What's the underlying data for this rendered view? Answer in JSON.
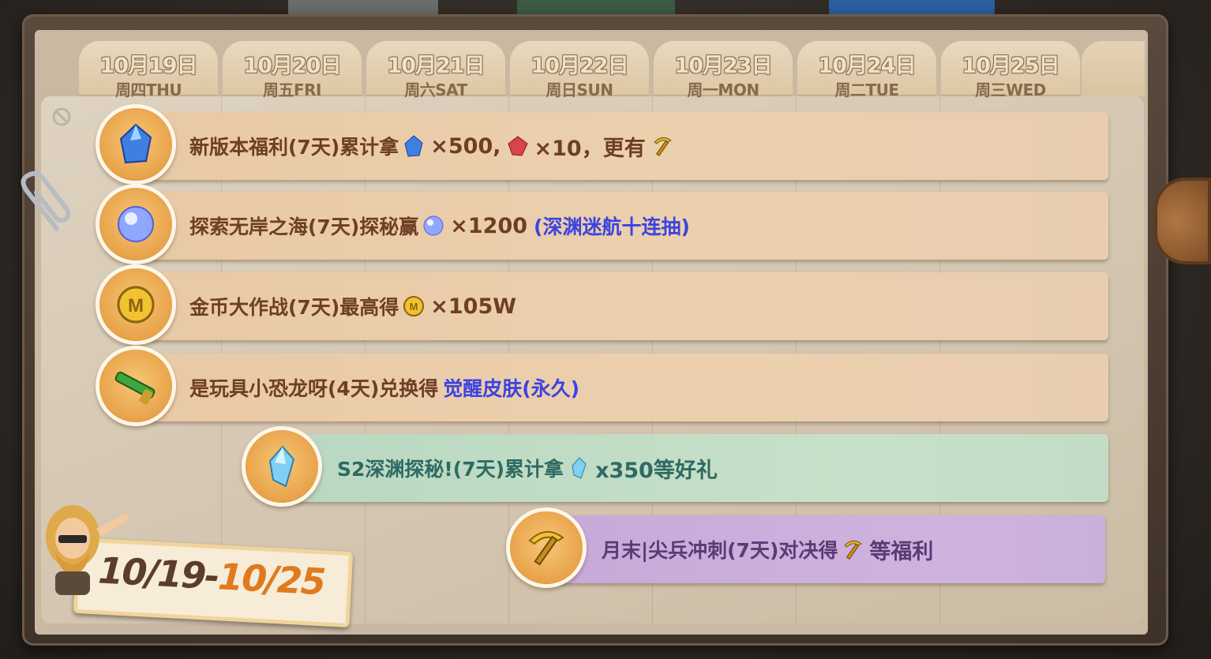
{
  "colors": {
    "frame": "#3d322a",
    "paper": "#d8cbb7",
    "orange_bar": "#ecd0ae",
    "green_bar": "#c8e0c9",
    "purple_bar": "#cfb3de",
    "highlight_blue": "#3b43e0",
    "tab_bg": "#e4d0b0"
  },
  "tabs": [
    {
      "date": "10月19日",
      "week": "周四THU"
    },
    {
      "date": "10月20日",
      "week": "周五FRI"
    },
    {
      "date": "10月21日",
      "week": "周六SAT"
    },
    {
      "date": "10月22日",
      "week": "周日SUN"
    },
    {
      "date": "10月23日",
      "week": "周一MON"
    },
    {
      "date": "10月24日",
      "week": "周二TUE"
    },
    {
      "date": "10月25日",
      "week": "周三WED"
    }
  ],
  "events": [
    {
      "icon": "blue-crystal-icon",
      "text1": "新版本福利(7天)累计拿",
      "mul1": "×500,",
      "mul2": "×10，更有",
      "color": "orange"
    },
    {
      "icon": "pearl-orb-icon",
      "text1": "探索无岸之海(7天)探秘赢",
      "mul1": "×1200",
      "highlight": "(深渊迷航十连抽)",
      "color": "orange"
    },
    {
      "icon": "gold-coin-icon",
      "text1": "金币大作战(7天)最高得",
      "mul1": "×105W",
      "color": "orange"
    },
    {
      "icon": "dino-gun-icon",
      "text1": "是玩具小恐龙呀(4天)兑换得",
      "highlight": "觉醒皮肤(永久)",
      "color": "orange"
    },
    {
      "icon": "ice-crystal-icon",
      "text1": "S2深渊探秘!(7天)累计拿",
      "mul1": "x350等好礼",
      "color": "green"
    },
    {
      "icon": "gold-pickaxe-icon",
      "text1": "月末|尖兵冲刺(7天)对决得",
      "mul1": "等福利",
      "color": "purple"
    }
  ],
  "badge": {
    "start": "10/19-",
    "end": "10/25"
  }
}
